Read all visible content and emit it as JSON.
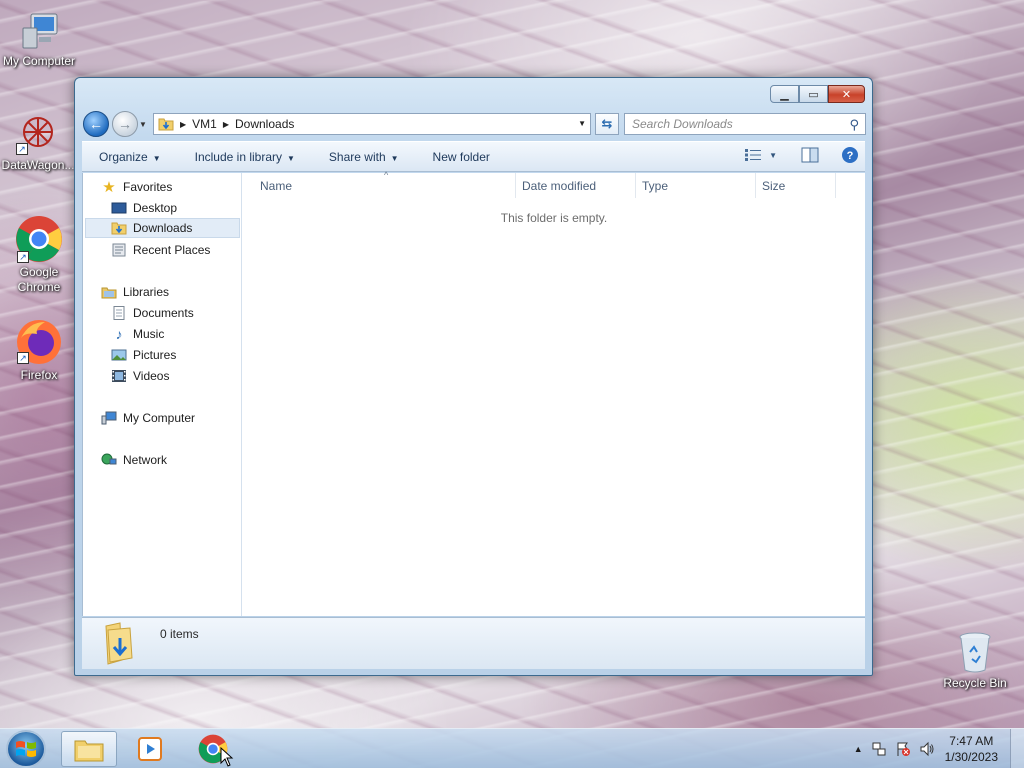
{
  "desktop": {
    "icons": [
      {
        "label": "My Computer",
        "icon": "monitor-icon"
      },
      {
        "label": "DataWagon...",
        "icon": "datawagon-icon"
      },
      {
        "label": "Google Chrome",
        "icon": "chrome-icon"
      },
      {
        "label": "Firefox",
        "icon": "firefox-icon"
      },
      {
        "label": "Recycle Bin",
        "icon": "recycle-bin-icon"
      }
    ]
  },
  "window": {
    "controls": {
      "minimize": "▁",
      "maximize": "▭",
      "close": "✕"
    },
    "breadcrumb": [
      "VM1",
      "Downloads"
    ],
    "search_placeholder": "Search Downloads",
    "toolbar": {
      "organize": "Organize",
      "include_in_library": "Include in library",
      "share_with": "Share with",
      "new_folder": "New folder"
    },
    "nav_pane": {
      "favorites": {
        "label": "Favorites",
        "items": [
          "Desktop",
          "Downloads",
          "Recent Places"
        ]
      },
      "libraries": {
        "label": "Libraries",
        "items": [
          "Documents",
          "Music",
          "Pictures",
          "Videos"
        ]
      },
      "computer": "My Computer",
      "network": "Network",
      "selected": "Downloads"
    },
    "columns": [
      "Name",
      "Date modified",
      "Type",
      "Size"
    ],
    "empty_message": "This folder is empty.",
    "details": {
      "item_count": "0 items"
    }
  },
  "taskbar": {
    "apps": [
      {
        "name": "Windows Explorer",
        "icon": "folder-icon",
        "active": true
      },
      {
        "name": "Media Player",
        "icon": "media-player-icon",
        "active": false
      },
      {
        "name": "Google Chrome",
        "icon": "chrome-icon",
        "active": false
      }
    ],
    "clock": {
      "time": "7:47 AM",
      "date": "1/30/2023"
    }
  },
  "colors": {
    "title_bar": "#c3d9ee",
    "selection": "#e2ecf7",
    "close_button": "#c8422a",
    "link_text": "#1e395b"
  }
}
